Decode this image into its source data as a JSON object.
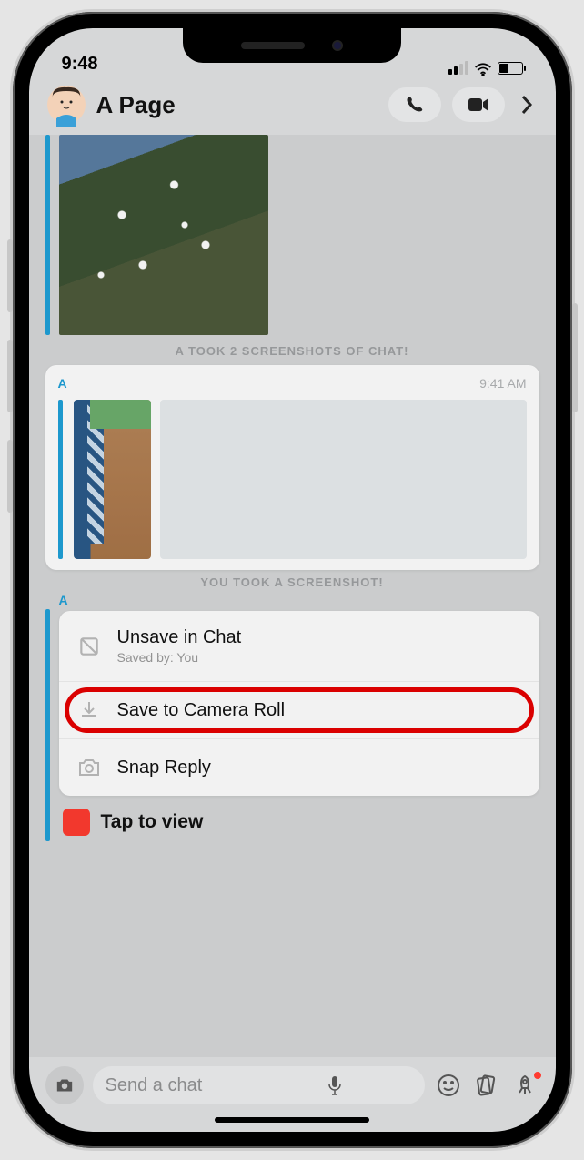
{
  "status": {
    "time": "9:48"
  },
  "header": {
    "title": "A Page"
  },
  "system_msg1": "A TOOK 2 SCREENSHOTS OF CHAT!",
  "bubble": {
    "sender": "A",
    "time": "9:41 AM"
  },
  "system_msg2": "YOU TOOK A SCREENSHOT!",
  "sender_label": "A",
  "actions": {
    "unsave": {
      "label": "Unsave in Chat",
      "sub": "Saved by: You"
    },
    "save": {
      "label": "Save to Camera Roll"
    },
    "reply": {
      "label": "Snap Reply"
    }
  },
  "tap": {
    "label": "Tap to view"
  },
  "input": {
    "placeholder": "Send a chat"
  }
}
